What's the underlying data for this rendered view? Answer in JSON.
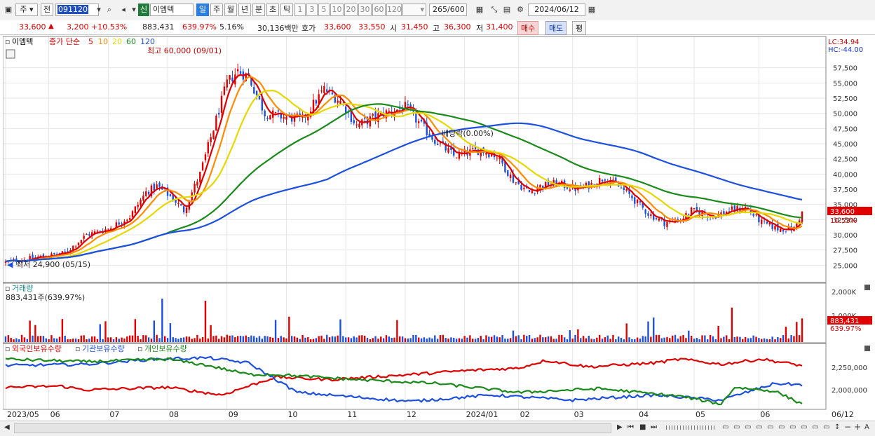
{
  "toolbar": {
    "market": "주",
    "prev": "전",
    "code": "091120",
    "badge": "신",
    "name": "이엠텍",
    "periods": [
      "일",
      "주",
      "월",
      "년",
      "분",
      "초",
      "틱"
    ],
    "active_period": "일",
    "intervals": [
      "1",
      "3",
      "5",
      "10",
      "20",
      "30",
      "60",
      "120"
    ],
    "count": "265",
    "count_total": "/600",
    "date": "2024/06/12"
  },
  "quote": {
    "price": "33,600",
    "change": "3,200",
    "change_pct": "+10.53%",
    "volume": "883,431",
    "vol_ratio": "639.97%",
    "turnover": "5.16%",
    "amount": "30,136백만",
    "ask_label": "호가",
    "ask": "33,600",
    "bid": "33,550",
    "open_label": "시",
    "open": "31,450",
    "high_label": "고",
    "high": "36,300",
    "low_label": "저",
    "low": "31,400",
    "buy": "매수",
    "sell": "매도",
    "eval": "평"
  },
  "price_panel": {
    "legend_name": "이엠텍",
    "legend_close": "종가 단순",
    "ma_labels": [
      "5",
      "10",
      "20",
      "60",
      "120"
    ],
    "ma_colors": [
      "#e00000",
      "#ff8c00",
      "#e6d800",
      "#1a8a1a",
      "#1e50e0"
    ],
    "high_note": "최고 60,000 (09/01)",
    "low_note": "최저 24,900 (05/15)",
    "mid_note": "배당락(0.00%)",
    "lc": "LC:34.94",
    "hc": "HC:-44.00",
    "y_ticks": [
      "57,500",
      "55,000",
      "52,500",
      "50,000",
      "47,500",
      "45,000",
      "42,500",
      "40,000",
      "37,500",
      "35,000",
      "32,500",
      "30,000",
      "27,500",
      "25,000"
    ],
    "last_price": "33,600",
    "last_pct": "10.53%"
  },
  "volume_panel": {
    "title": "거래량",
    "sub": "883,431주(639.97%)",
    "y_ticks": [
      "2,000K",
      "1,000K"
    ],
    "last": "883,431",
    "last_pct": "639.97%"
  },
  "holdings_panel": {
    "legends": [
      "외국인보유수량",
      "기관보유수량",
      "개인보유수량"
    ],
    "colors": [
      "#e00000",
      "#1e50e0",
      "#1a8a1a"
    ],
    "y_ticks": [
      "2,250,000",
      "2,000,000"
    ]
  },
  "x_axis": {
    "labels": [
      "2023/05",
      "06",
      "07",
      "08",
      "09",
      "10",
      "11",
      "12",
      "2024/01",
      "02",
      "03",
      "04",
      "05",
      "06"
    ],
    "right_label": "06/12"
  },
  "chart_data": {
    "type": "line",
    "y_range": [
      22500,
      60000
    ],
    "ma_periods": [
      5,
      10,
      20,
      60,
      120
    ],
    "seed_price": 25500,
    "close_anchors": [
      [
        0,
        25500
      ],
      [
        15,
        26500
      ],
      [
        22,
        27000
      ],
      [
        30,
        30000
      ],
      [
        38,
        31000
      ],
      [
        46,
        33000
      ],
      [
        52,
        37000
      ],
      [
        56,
        38000
      ],
      [
        62,
        36000
      ],
      [
        66,
        34000
      ],
      [
        72,
        40000
      ],
      [
        78,
        49000
      ],
      [
        82,
        55000
      ],
      [
        86,
        57000
      ],
      [
        90,
        56000
      ],
      [
        96,
        50000
      ],
      [
        102,
        49500
      ],
      [
        110,
        49000
      ],
      [
        118,
        54000
      ],
      [
        124,
        52000
      ],
      [
        130,
        48000
      ],
      [
        140,
        50000
      ],
      [
        148,
        51000
      ],
      [
        158,
        46000
      ],
      [
        166,
        43000
      ],
      [
        176,
        44000
      ],
      [
        182,
        43000
      ],
      [
        188,
        39000
      ],
      [
        194,
        37000
      ],
      [
        198,
        38000
      ],
      [
        204,
        38500
      ],
      [
        212,
        37500
      ],
      [
        218,
        38500
      ],
      [
        222,
        39500
      ],
      [
        230,
        37000
      ],
      [
        238,
        33500
      ],
      [
        244,
        32000
      ],
      [
        250,
        32500
      ],
      [
        254,
        34000
      ],
      [
        262,
        33000
      ],
      [
        268,
        34000
      ],
      [
        274,
        34500
      ],
      [
        280,
        32000
      ],
      [
        286,
        31000
      ],
      [
        292,
        31000
      ],
      [
        295,
        33600
      ]
    ],
    "foreign_anchors": [
      [
        0,
        2030
      ],
      [
        20,
        2040
      ],
      [
        30,
        2010
      ],
      [
        60,
        2030
      ],
      [
        80,
        1970
      ],
      [
        100,
        2110
      ],
      [
        120,
        2090
      ],
      [
        150,
        2130
      ],
      [
        170,
        2160
      ],
      [
        190,
        2180
      ],
      [
        200,
        2240
      ],
      [
        216,
        2190
      ],
      [
        240,
        2220
      ],
      [
        250,
        2250
      ],
      [
        265,
        2210
      ],
      [
        280,
        2250
      ],
      [
        295,
        2200
      ]
    ],
    "institution_anchors": [
      [
        0,
        2200
      ],
      [
        30,
        2210
      ],
      [
        55,
        2250
      ],
      [
        75,
        2260
      ],
      [
        90,
        2220
      ],
      [
        108,
        1990
      ],
      [
        150,
        1920
      ],
      [
        180,
        1970
      ],
      [
        210,
        1930
      ],
      [
        240,
        1970
      ],
      [
        265,
        1930
      ],
      [
        285,
        2060
      ],
      [
        295,
        2050
      ]
    ],
    "individual_anchors": [
      [
        0,
        2250
      ],
      [
        30,
        2230
      ],
      [
        60,
        2250
      ],
      [
        75,
        2200
      ],
      [
        90,
        2130
      ],
      [
        100,
        2130
      ],
      [
        130,
        2090
      ],
      [
        160,
        2060
      ],
      [
        190,
        1990
      ],
      [
        220,
        2020
      ],
      [
        250,
        1960
      ],
      [
        265,
        1900
      ],
      [
        270,
        2030
      ],
      [
        285,
        2000
      ],
      [
        295,
        1900
      ]
    ]
  }
}
